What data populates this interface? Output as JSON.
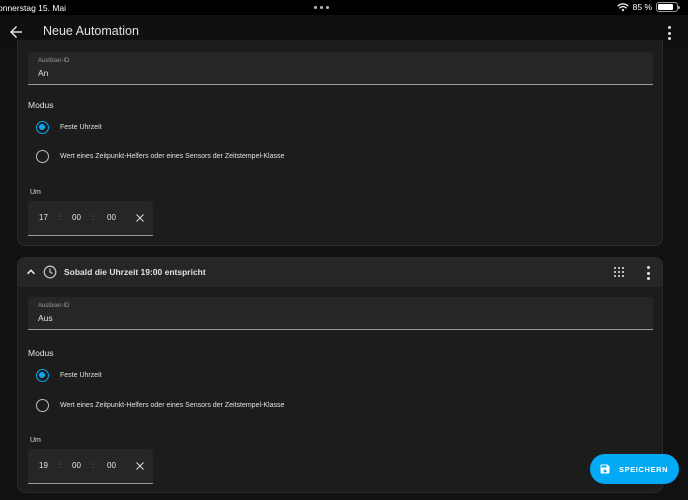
{
  "statusbar": {
    "date": "onnerstag 15. Mai",
    "battery": "85 %",
    "battery_level_fraction": 0.85,
    "icons": [
      "more-dots-icon",
      "wifi-icon",
      "battery-icon"
    ]
  },
  "header": {
    "title": "Neue Automation",
    "icons": [
      "back-arrow-icon",
      "overflow-menu-icon"
    ]
  },
  "triggers": [
    {
      "title": "",
      "id_label": "Auslöser-ID",
      "id_value": "An",
      "mode_label": "Modus",
      "options": [
        "Feste Uhrzeit",
        "Wert eines Zeitpunkt-Helfers oder eines Sensors der Zeitstempel-Klasse"
      ],
      "selected_option": "Feste Uhrzeit",
      "time_label": "Um",
      "time": {
        "hours": "17",
        "minutes": "00",
        "seconds": "00",
        "separator": ":"
      }
    },
    {
      "title": "Sobald die Uhrzeit 19:00 entspricht",
      "id_label": "Auslöser-ID",
      "id_value": "Aus",
      "mode_label": "Modus",
      "options": [
        "Feste Uhrzeit",
        "Wert eines Zeitpunkt-Helfers oder eines Sensors der Zeitstempel-Klasse"
      ],
      "selected_option": "Feste Uhrzeit",
      "time_label": "Um",
      "time": {
        "hours": "19",
        "minutes": "00",
        "seconds": "00",
        "separator": ":"
      },
      "header_icons": [
        "chevron-up-icon",
        "clock-icon",
        "drag-handle-icon",
        "overflow-menu-icon"
      ]
    }
  ],
  "save_button": {
    "label": "SPEICHERN",
    "icon": "floppy-disk-icon"
  },
  "colors": {
    "accent": "#03a9f4",
    "background": "#111111",
    "card": "#1c1c1c",
    "field": "#262626",
    "text": "#e1e1e1"
  }
}
